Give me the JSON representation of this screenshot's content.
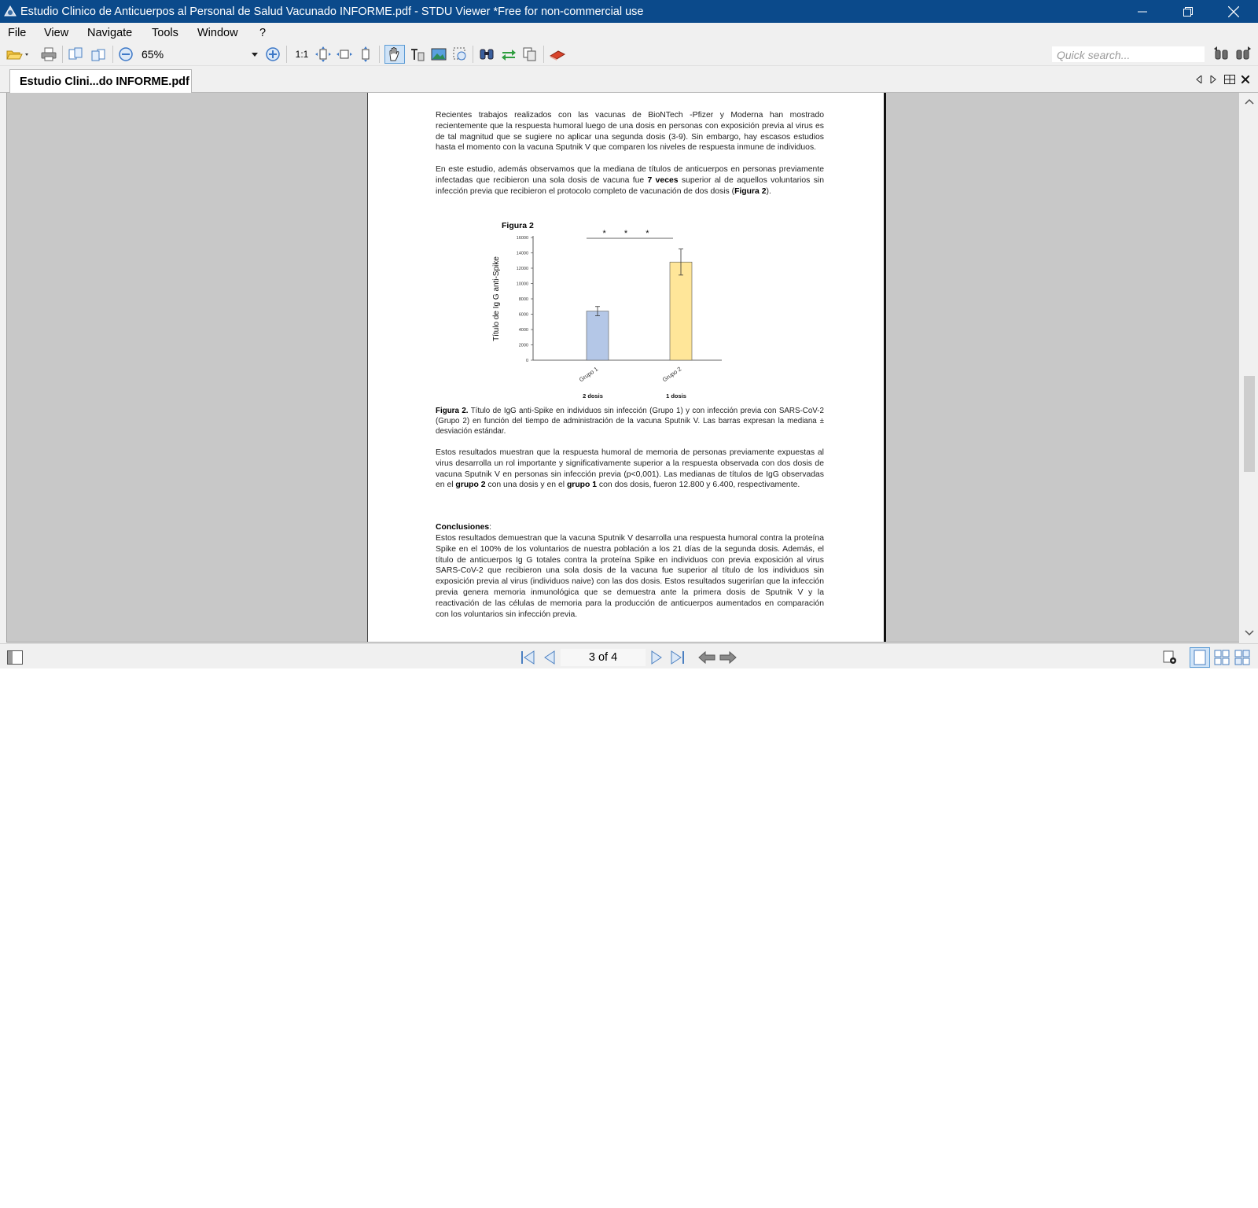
{
  "window": {
    "title": "Estudio Clinico de Anticuerpos al Personal de Salud  Vacunado INFORME.pdf - STDU Viewer *Free for non-commercial use"
  },
  "menu": {
    "file": "File",
    "view": "View",
    "navigate": "Navigate",
    "tools": "Tools",
    "window": "Window",
    "help": "?"
  },
  "toolbar": {
    "zoom": "65%",
    "actual_size": "1:1",
    "quick_search_placeholder": "Quick search..."
  },
  "tab": {
    "label": "Estudio Clini...do INFORME.pdf"
  },
  "document": {
    "para1": "Recientes trabajos realizados con las vacunas de BioNTech -Pfizer y Moderna han mostrado recientemente que la respuesta humoral luego de una dosis en personas con exposición previa al virus es de tal magnitud que se sugiere no aplicar una segunda dosis (3-9). Sin embargo, hay escasos estudios hasta el momento con la vacuna Sputnik V que comparen los niveles de respuesta inmune de individuos.",
    "para2_a": "En este estudio, además observamos que la mediana de títulos de anticuerpos en personas previamente infectadas que recibieron una sola dosis de vacuna fue ",
    "para2_bold": "7 veces",
    "para2_b": " superior al de aquellos voluntarios sin infección previa que recibieron el protocolo completo de vacunación de dos dosis (",
    "para2_fig": "Figura 2",
    "para2_c": ").",
    "figure_title": "Figura 2",
    "caption_bold": "Figura 2.",
    "caption": " Título de IgG anti-Spike en individuos sin infección (Grupo 1) y con infección previa con SARS-CoV-2 (Grupo 2) en función del tiempo de administración de la vacuna Sputnik V. Las barras expresan la mediana ± desviación estándar.",
    "para3_a": "Estos resultados muestran que la respuesta humoral de memoria de personas previamente expuestas al virus desarrolla un rol importante y significativamente superior a la respuesta observada con dos dosis de vacuna Sputnik V en personas sin infección previa (p<0,001). Las medianas de títulos de IgG observadas en el ",
    "para3_bold1": "grupo 2",
    "para3_b": " con una dosis y en el ",
    "para3_bold2": "grupo 1",
    "para3_c": " con dos dosis, fueron 12.800 y 6.400, respectivamente.",
    "conclusions_heading": "Conclusiones",
    "conclusions_colon": ":",
    "conclusions": "Estos resultados demuestran que la vacuna Sputnik V desarrolla una respuesta humoral contra la proteína Spike en el 100% de los voluntarios de nuestra población a los 21 días de la segunda dosis. Además, el título de anticuerpos Ig G totales contra la proteína Spike en individuos con previa exposición al virus SARS-CoV-2 que recibieron una sola dosis de la vacuna fue superior al título de los individuos sin exposición previa al virus (individuos naive) con las dos dosis. Estos resultados sugerirían que la infección previa genera memoria inmunológica que se demuestra ante la primera dosis de Sputnik V y la reactivación de las células de memoria para la producción de anticuerpos aumentados en comparación con los voluntarios sin infección previa."
  },
  "chart_data": {
    "type": "bar",
    "ylabel": "Título de Ig G anti-Spike",
    "ylim": [
      0,
      16000
    ],
    "yticks": [
      0,
      2000,
      4000,
      6000,
      8000,
      10000,
      12000,
      14000,
      16000
    ],
    "ytick_labels": [
      "0",
      "2000",
      "4000",
      "6000",
      "8000",
      "10000",
      "12000",
      "14000",
      "16000"
    ],
    "categories": [
      "Grupo 1",
      "Grupo 2"
    ],
    "sublabels": [
      "2 dosis",
      "1 dosis"
    ],
    "values": [
      6400,
      12800
    ],
    "errors": [
      600,
      1700
    ],
    "colors": [
      "#b4c7e7",
      "#ffe699"
    ],
    "significance": "* * *"
  },
  "statusbar": {
    "page_indicator": "3 of 4"
  }
}
